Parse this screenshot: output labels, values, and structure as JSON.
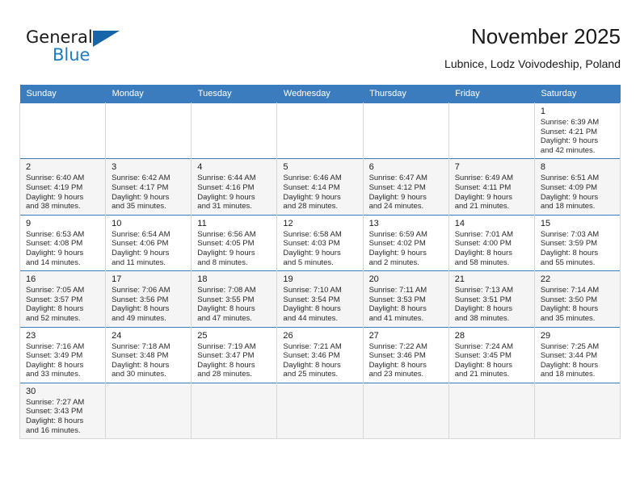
{
  "brand": {
    "name_part1": "General",
    "name_part2": "Blue",
    "triangle_color": "#1565a8",
    "blue_color": "#1f7cc0"
  },
  "header": {
    "title": "November 2025",
    "subtitle": "Lubnice, Lodz Voivodeship, Poland"
  },
  "theme": {
    "header_row_bg": "#3a7cbe",
    "header_row_text": "#ffffff",
    "alt_row_bg": "#f5f5f5",
    "cell_border": "#d7d7d7"
  },
  "columns": [
    "Sunday",
    "Monday",
    "Tuesday",
    "Wednesday",
    "Thursday",
    "Friday",
    "Saturday"
  ],
  "labels": {
    "sunrise_prefix": "Sunrise:",
    "sunset_prefix": "Sunset:",
    "daylight_prefix": "Daylight:"
  },
  "weeks": [
    [
      {
        "empty": true
      },
      {
        "empty": true
      },
      {
        "empty": true
      },
      {
        "empty": true
      },
      {
        "empty": true
      },
      {
        "empty": true
      },
      {
        "day": "1",
        "sunrise": "Sunrise: 6:39 AM",
        "sunset": "Sunset: 4:21 PM",
        "daylight_1": "Daylight: 9 hours",
        "daylight_2": "and 42 minutes."
      }
    ],
    [
      {
        "day": "2",
        "sunrise": "Sunrise: 6:40 AM",
        "sunset": "Sunset: 4:19 PM",
        "daylight_1": "Daylight: 9 hours",
        "daylight_2": "and 38 minutes."
      },
      {
        "day": "3",
        "sunrise": "Sunrise: 6:42 AM",
        "sunset": "Sunset: 4:17 PM",
        "daylight_1": "Daylight: 9 hours",
        "daylight_2": "and 35 minutes."
      },
      {
        "day": "4",
        "sunrise": "Sunrise: 6:44 AM",
        "sunset": "Sunset: 4:16 PM",
        "daylight_1": "Daylight: 9 hours",
        "daylight_2": "and 31 minutes."
      },
      {
        "day": "5",
        "sunrise": "Sunrise: 6:46 AM",
        "sunset": "Sunset: 4:14 PM",
        "daylight_1": "Daylight: 9 hours",
        "daylight_2": "and 28 minutes."
      },
      {
        "day": "6",
        "sunrise": "Sunrise: 6:47 AM",
        "sunset": "Sunset: 4:12 PM",
        "daylight_1": "Daylight: 9 hours",
        "daylight_2": "and 24 minutes."
      },
      {
        "day": "7",
        "sunrise": "Sunrise: 6:49 AM",
        "sunset": "Sunset: 4:11 PM",
        "daylight_1": "Daylight: 9 hours",
        "daylight_2": "and 21 minutes."
      },
      {
        "day": "8",
        "sunrise": "Sunrise: 6:51 AM",
        "sunset": "Sunset: 4:09 PM",
        "daylight_1": "Daylight: 9 hours",
        "daylight_2": "and 18 minutes."
      }
    ],
    [
      {
        "day": "9",
        "sunrise": "Sunrise: 6:53 AM",
        "sunset": "Sunset: 4:08 PM",
        "daylight_1": "Daylight: 9 hours",
        "daylight_2": "and 14 minutes."
      },
      {
        "day": "10",
        "sunrise": "Sunrise: 6:54 AM",
        "sunset": "Sunset: 4:06 PM",
        "daylight_1": "Daylight: 9 hours",
        "daylight_2": "and 11 minutes."
      },
      {
        "day": "11",
        "sunrise": "Sunrise: 6:56 AM",
        "sunset": "Sunset: 4:05 PM",
        "daylight_1": "Daylight: 9 hours",
        "daylight_2": "and 8 minutes."
      },
      {
        "day": "12",
        "sunrise": "Sunrise: 6:58 AM",
        "sunset": "Sunset: 4:03 PM",
        "daylight_1": "Daylight: 9 hours",
        "daylight_2": "and 5 minutes."
      },
      {
        "day": "13",
        "sunrise": "Sunrise: 6:59 AM",
        "sunset": "Sunset: 4:02 PM",
        "daylight_1": "Daylight: 9 hours",
        "daylight_2": "and 2 minutes."
      },
      {
        "day": "14",
        "sunrise": "Sunrise: 7:01 AM",
        "sunset": "Sunset: 4:00 PM",
        "daylight_1": "Daylight: 8 hours",
        "daylight_2": "and 58 minutes."
      },
      {
        "day": "15",
        "sunrise": "Sunrise: 7:03 AM",
        "sunset": "Sunset: 3:59 PM",
        "daylight_1": "Daylight: 8 hours",
        "daylight_2": "and 55 minutes."
      }
    ],
    [
      {
        "day": "16",
        "sunrise": "Sunrise: 7:05 AM",
        "sunset": "Sunset: 3:57 PM",
        "daylight_1": "Daylight: 8 hours",
        "daylight_2": "and 52 minutes."
      },
      {
        "day": "17",
        "sunrise": "Sunrise: 7:06 AM",
        "sunset": "Sunset: 3:56 PM",
        "daylight_1": "Daylight: 8 hours",
        "daylight_2": "and 49 minutes."
      },
      {
        "day": "18",
        "sunrise": "Sunrise: 7:08 AM",
        "sunset": "Sunset: 3:55 PM",
        "daylight_1": "Daylight: 8 hours",
        "daylight_2": "and 47 minutes."
      },
      {
        "day": "19",
        "sunrise": "Sunrise: 7:10 AM",
        "sunset": "Sunset: 3:54 PM",
        "daylight_1": "Daylight: 8 hours",
        "daylight_2": "and 44 minutes."
      },
      {
        "day": "20",
        "sunrise": "Sunrise: 7:11 AM",
        "sunset": "Sunset: 3:53 PM",
        "daylight_1": "Daylight: 8 hours",
        "daylight_2": "and 41 minutes."
      },
      {
        "day": "21",
        "sunrise": "Sunrise: 7:13 AM",
        "sunset": "Sunset: 3:51 PM",
        "daylight_1": "Daylight: 8 hours",
        "daylight_2": "and 38 minutes."
      },
      {
        "day": "22",
        "sunrise": "Sunrise: 7:14 AM",
        "sunset": "Sunset: 3:50 PM",
        "daylight_1": "Daylight: 8 hours",
        "daylight_2": "and 35 minutes."
      }
    ],
    [
      {
        "day": "23",
        "sunrise": "Sunrise: 7:16 AM",
        "sunset": "Sunset: 3:49 PM",
        "daylight_1": "Daylight: 8 hours",
        "daylight_2": "and 33 minutes."
      },
      {
        "day": "24",
        "sunrise": "Sunrise: 7:18 AM",
        "sunset": "Sunset: 3:48 PM",
        "daylight_1": "Daylight: 8 hours",
        "daylight_2": "and 30 minutes."
      },
      {
        "day": "25",
        "sunrise": "Sunrise: 7:19 AM",
        "sunset": "Sunset: 3:47 PM",
        "daylight_1": "Daylight: 8 hours",
        "daylight_2": "and 28 minutes."
      },
      {
        "day": "26",
        "sunrise": "Sunrise: 7:21 AM",
        "sunset": "Sunset: 3:46 PM",
        "daylight_1": "Daylight: 8 hours",
        "daylight_2": "and 25 minutes."
      },
      {
        "day": "27",
        "sunrise": "Sunrise: 7:22 AM",
        "sunset": "Sunset: 3:46 PM",
        "daylight_1": "Daylight: 8 hours",
        "daylight_2": "and 23 minutes."
      },
      {
        "day": "28",
        "sunrise": "Sunrise: 7:24 AM",
        "sunset": "Sunset: 3:45 PM",
        "daylight_1": "Daylight: 8 hours",
        "daylight_2": "and 21 minutes."
      },
      {
        "day": "29",
        "sunrise": "Sunrise: 7:25 AM",
        "sunset": "Sunset: 3:44 PM",
        "daylight_1": "Daylight: 8 hours",
        "daylight_2": "and 18 minutes."
      }
    ],
    [
      {
        "day": "30",
        "sunrise": "Sunrise: 7:27 AM",
        "sunset": "Sunset: 3:43 PM",
        "daylight_1": "Daylight: 8 hours",
        "daylight_2": "and 16 minutes."
      },
      {
        "empty": true
      },
      {
        "empty": true
      },
      {
        "empty": true
      },
      {
        "empty": true
      },
      {
        "empty": true
      },
      {
        "empty": true
      }
    ]
  ]
}
